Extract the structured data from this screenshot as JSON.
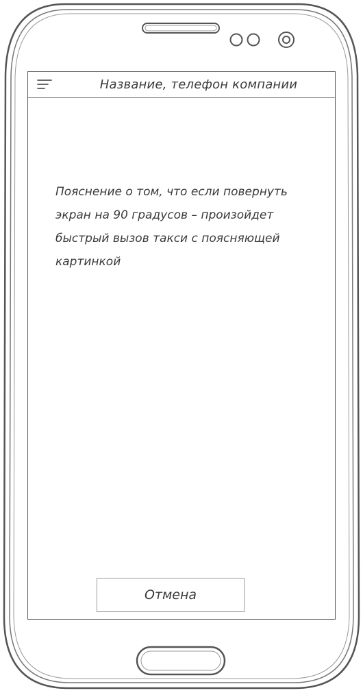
{
  "header": {
    "title": "Название, телефон компании",
    "menu_icon": "hamburger-menu-icon"
  },
  "main": {
    "explanation": "Пояснение о том,  что если повернуть экран на 90 градусов – произойдет быстрый вызов такси с поясняющей картинкой"
  },
  "actions": {
    "cancel_label": "Отмена"
  },
  "colors": {
    "outline": "#5a5a5a",
    "text": "#3a3a3a",
    "background": "#ffffff"
  }
}
